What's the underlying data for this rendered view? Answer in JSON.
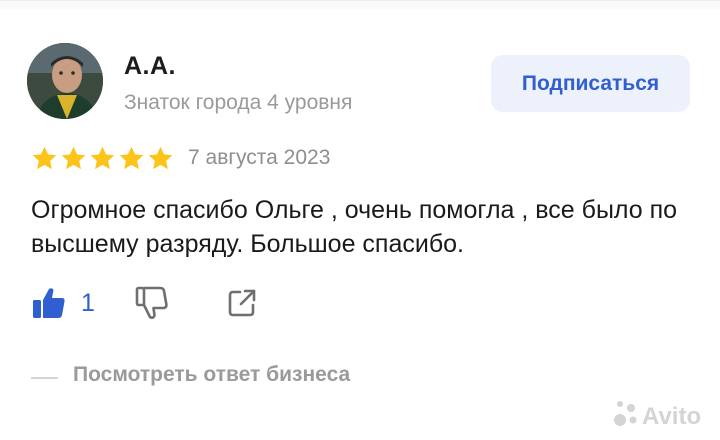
{
  "review": {
    "author_name": "А.А.",
    "author_level": "Знаток города 4 уровня",
    "subscribe_label": "Подписаться",
    "rating": 5,
    "date": "7 августа 2023",
    "text": "Огромное спасибо Ольге , очень помогла , все было по высшему разряду. Большое спасибо.",
    "likes": "1",
    "business_reply_link": "Посмотреть ответ бизнеса"
  },
  "icons": {
    "like": "thumbs-up-icon",
    "dislike": "thumbs-down-icon",
    "share": "share-icon",
    "star": "star-icon"
  },
  "colors": {
    "accent": "#2f5fd0",
    "star": "#fcc419",
    "subscribe_bg": "#edf1fb",
    "muted": "#9a9a9a"
  },
  "watermark": "Avito"
}
